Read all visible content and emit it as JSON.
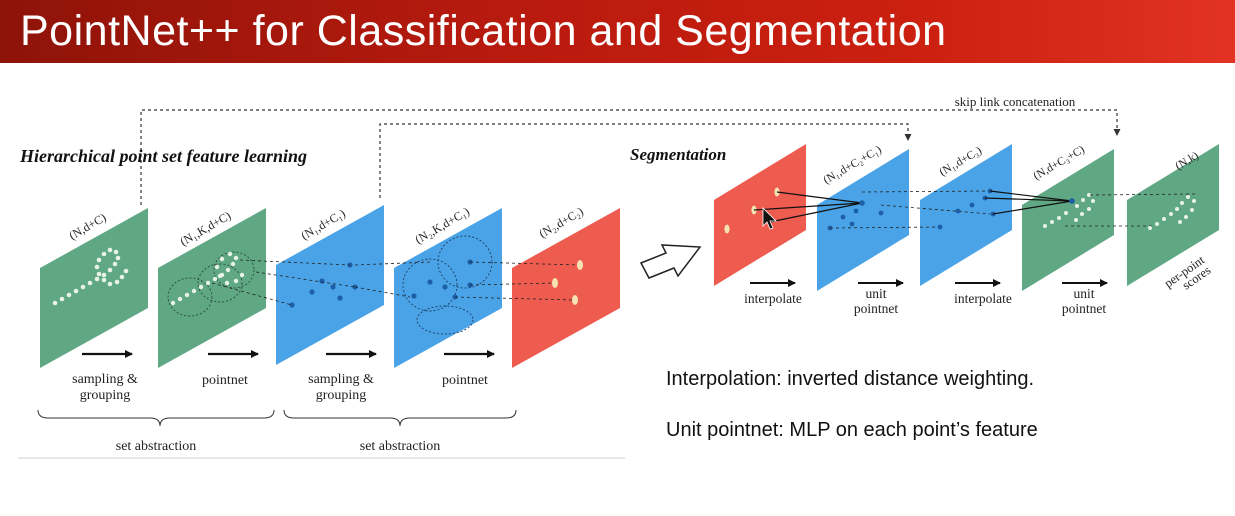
{
  "slide": {
    "title": "PointNet++ for Classification and Segmentation"
  },
  "diagram": {
    "left_section_title": "Hierarchical point set feature learning",
    "right_section_title": "Segmentation",
    "skip_link_label": "skip link concatenation",
    "planes": {
      "p1": "(N,d+C)",
      "p2": "(N₁,K,d+C)",
      "p3": "(N₁,d+C₁)",
      "p4": "(N₂,K,d+C₁)",
      "p5": "(N₂,d+C₂)",
      "s2": "(N₁,d+C₂+C₁)",
      "s3": "(N₁,d+C₃)",
      "s4": "(N,d+C₃+C)",
      "s5": "(N,k)"
    },
    "steps": {
      "sampling_1": [
        "sampling &",
        "grouping"
      ],
      "pointnet_1": "pointnet",
      "sampling_2": [
        "sampling &",
        "grouping"
      ],
      "pointnet_2": "pointnet",
      "interpolate_1": "interpolate",
      "unit_pointnet_1": [
        "unit",
        "pointnet"
      ],
      "interpolate_2": "interpolate",
      "unit_pointnet_2": [
        "unit",
        "pointnet"
      ],
      "per_point_scores": [
        "per-point",
        "scores"
      ]
    },
    "braces": [
      "set abstraction",
      "set abstraction"
    ],
    "colors": {
      "green": "#5fa883",
      "blue": "#4aa3e6",
      "red": "#ee5b4f",
      "title_red": "#c41e10"
    }
  },
  "notes": {
    "interpolation": "Interpolation: inverted distance weighting.",
    "unit_pointnet": "Unit pointnet: MLP on each point’s feature"
  }
}
